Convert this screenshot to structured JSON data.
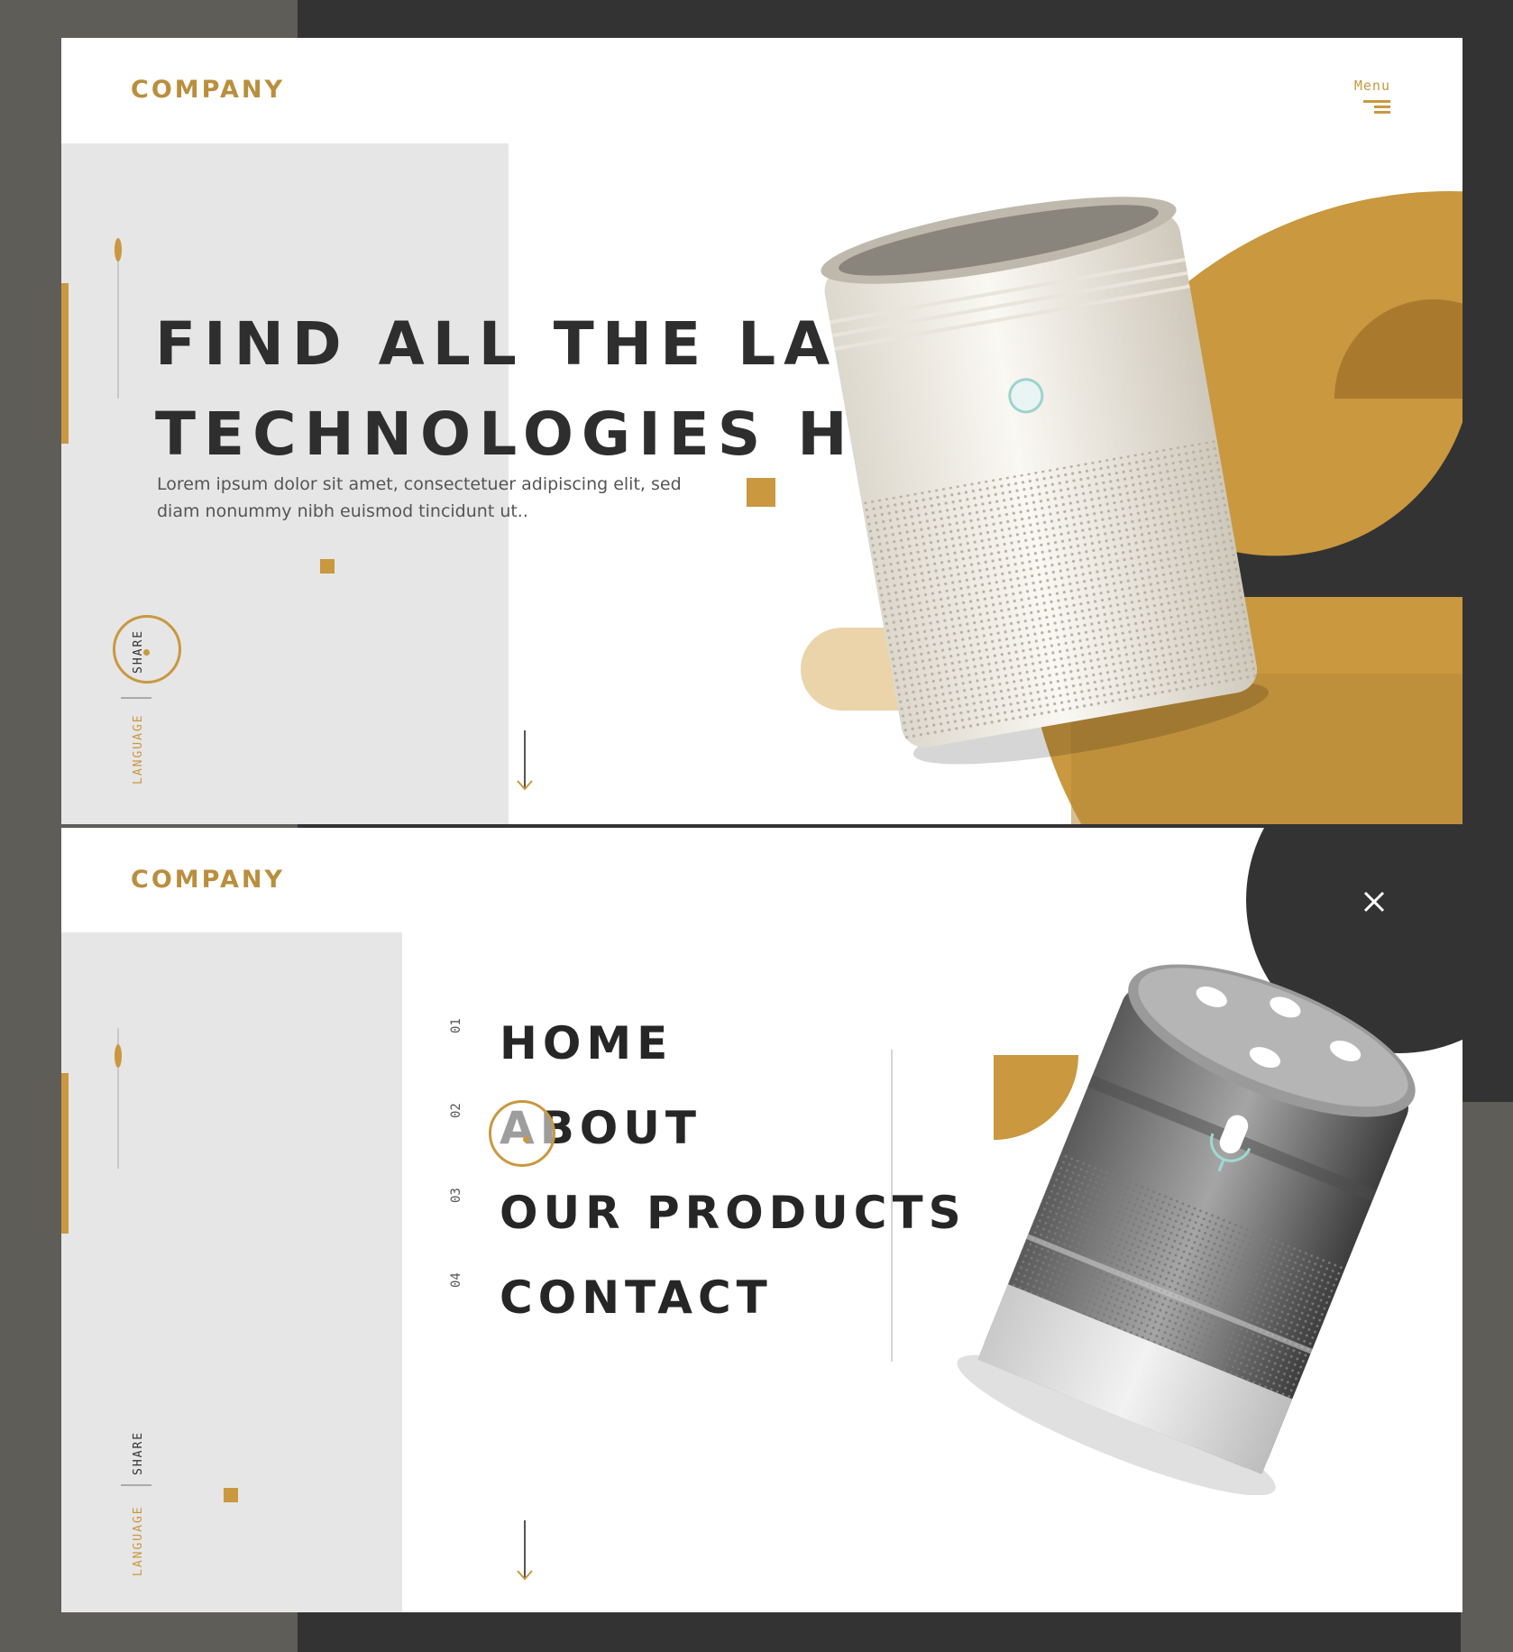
{
  "colors": {
    "accent": "#c9983f",
    "dark": "#333333",
    "panel": "#ffffff",
    "side_block": "#e6e6e6",
    "frame": "#5f5d58"
  },
  "hero": {
    "brand": "COMPANY",
    "menu_label": "Menu",
    "headline_line1": "FIND ALL THE LATEST",
    "headline_line2": "TECHNOLOGIES HERE",
    "lead_line1": "Lorem ipsum dolor sit amet, consectetuer adipiscing elit, sed",
    "lead_line2": "diam nonummy nibh euismod tincidunt ut..",
    "share_label": "SHARE",
    "language_label": "LANGUAGE",
    "icons": {
      "menu": "menu-icon",
      "scroll": "arrow-down-icon",
      "product": "air-purifier-illustration"
    }
  },
  "menu_page": {
    "brand": "COMPANY",
    "nav": [
      {
        "num": "01",
        "label": "HOME"
      },
      {
        "num": "02",
        "label": "ABOUT"
      },
      {
        "num": "03",
        "label": "OUR PRODUCTS"
      },
      {
        "num": "04",
        "label": "CONTACT"
      }
    ],
    "share_label": "SHARE",
    "language_label": "LANGUAGE",
    "icons": {
      "close": "close-icon",
      "scroll": "arrow-down-icon",
      "product": "smart-speaker-illustration"
    }
  }
}
